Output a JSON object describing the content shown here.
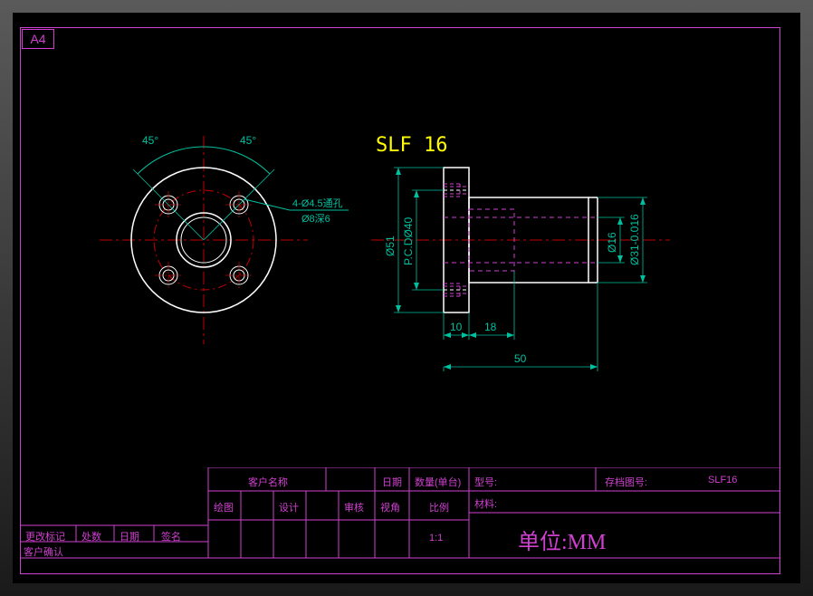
{
  "paper": "A4",
  "part_title": "SLF 16",
  "front_view": {
    "angle_left": "45°",
    "angle_right": "45°",
    "hole_note1": "4-Ø4.5通孔",
    "hole_note2": "Ø8深6"
  },
  "side_view": {
    "dia1": "Ø51",
    "pcd": "P.C.DØ40",
    "dia3": "Ø16",
    "dia4": "Ø31-0.016",
    "len1": "10",
    "len2": "18",
    "len3": "50"
  },
  "title_block": {
    "row1": {
      "customer_label": "客户名称",
      "date_label": "日期",
      "qty_label": "数量(单台)",
      "model_label": "型号:",
      "archive_label": "存档图号:",
      "archive_val": "SLF16"
    },
    "row2": {
      "draw": "绘图",
      "design": "设计",
      "review": "审核",
      "angle": "视角",
      "scale_label": "比例",
      "material": "材料:"
    },
    "row3": {
      "scale_val": "1:1"
    },
    "left_block": {
      "change": "更改标记",
      "place": "处数",
      "date": "日期",
      "sign": "签名",
      "confirm": "客户确认"
    },
    "unit": "单位:MM"
  }
}
